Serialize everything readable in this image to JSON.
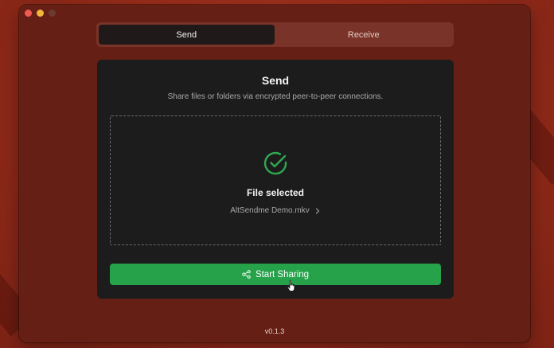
{
  "tabs": {
    "send_label": "Send",
    "receive_label": "Receive",
    "active": "Send"
  },
  "card": {
    "title": "Send",
    "subtitle": "Share files or folders via encrypted peer-to-peer connections.",
    "file_status": "File selected",
    "file_name": "AltSendme Demo.mkv",
    "button_label": "Start Sharing"
  },
  "footer": {
    "version": "v0.1.3"
  },
  "colors": {
    "accent_green": "#26a24a",
    "window_bg": "#651f14",
    "card_bg": "#1c1c1c"
  },
  "icons": {
    "status": "check-circle-icon",
    "file_link": "chevron-right-icon",
    "button": "share-icon"
  }
}
